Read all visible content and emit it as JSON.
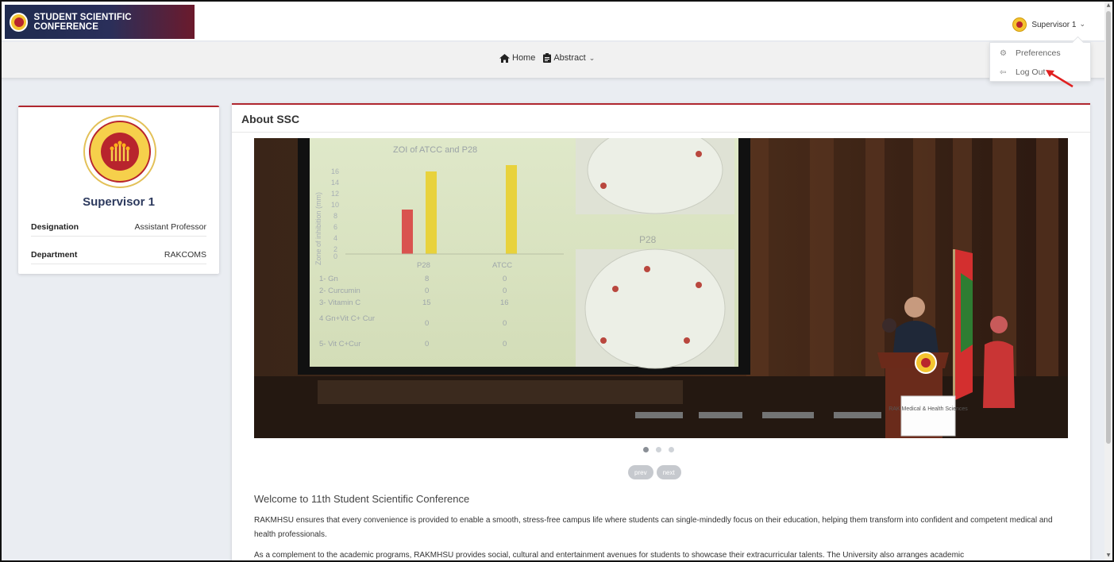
{
  "app": {
    "title": "STUDENT SCIENTIFIC CONFERENCE"
  },
  "user": {
    "name": "Supervisor 1",
    "chevron": "⌄"
  },
  "nav": {
    "home": "Home",
    "abstract": "Abstract",
    "abstract_chevron": "⌄"
  },
  "dropdown": {
    "items": [
      {
        "label": "Preferences",
        "icon": "gear-icon"
      },
      {
        "label": "Log Out",
        "icon": "logout-icon"
      }
    ]
  },
  "profile": {
    "name": "Supervisor 1",
    "rows": [
      {
        "label": "Designation",
        "value": "Assistant Professor"
      },
      {
        "label": "Department",
        "value": "RAKCOMS"
      }
    ]
  },
  "main": {
    "title": "About SSC",
    "carousel": {
      "slide_count": 3,
      "active": 0,
      "prev": "prev",
      "next": "next",
      "slide_chart": {
        "title": "ZOI of ATCC and P28",
        "ylabel": "Zone of inhibition (mm)",
        "yticks": [
          "16",
          "14",
          "12",
          "10",
          "8",
          "6",
          "4",
          "2",
          "0"
        ],
        "columns": [
          "P28",
          "ATCC"
        ],
        "rows": [
          {
            "label": "1- Gn",
            "p28": "8",
            "atcc": "0"
          },
          {
            "label": "2- Curcumin",
            "p28": "0",
            "atcc": "0"
          },
          {
            "label": "3- Vitamin C",
            "p28": "15",
            "atcc": "16"
          },
          {
            "label": "4 Gn+Vit C+ Cur",
            "p28": "0",
            "atcc": "0"
          },
          {
            "label": "5- Vit C+Cur",
            "p28": "0",
            "atcc": "0"
          }
        ],
        "plate_label": "P28"
      },
      "podium_sign": "RAK Medical & Health Sciences"
    },
    "welcome": "Welcome to 11th Student Scientific Conference",
    "paragraphs": [
      "RAKMHSU ensures that every convenience is provided to enable a smooth, stress-free campus life where students can single-mindedly focus on their education, helping them transform into confident and competent medical and health professionals.",
      "As a complement to the academic programs, RAKMHSU provides social, cultural and entertainment avenues for students to showcase their extracurricular talents. The University also arranges academic"
    ]
  },
  "colors": {
    "accent": "#b0272f",
    "brand_dark": "#1f2b4f",
    "gold": "#f4c430"
  }
}
